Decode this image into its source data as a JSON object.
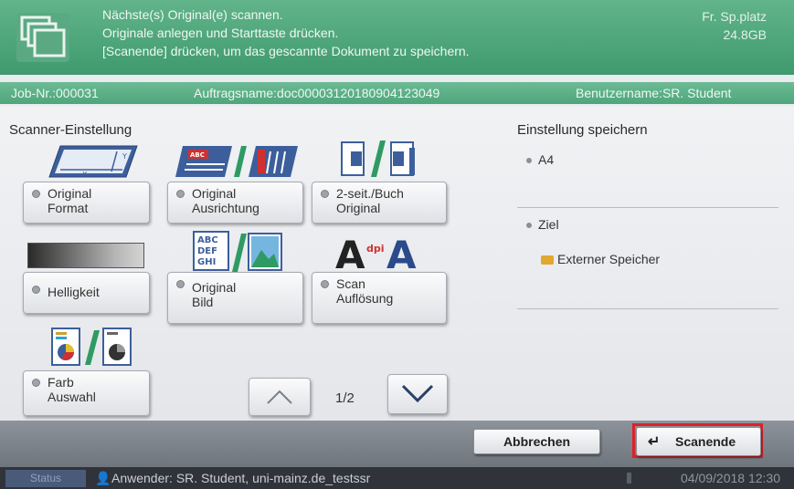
{
  "header": {
    "messages": [
      "Nächste(s) Original(e) scannen.",
      "Originale anlegen und Starttaste drücken.",
      "[Scanende] drücken, um das gescannte Dokument zu speichern."
    ],
    "free_space_label": "Fr. Sp.platz",
    "free_space_value": "24.8GB"
  },
  "jobbar": {
    "job_nr": "Job-Nr.:000031",
    "job_name": "Auftragsname:doc00003120180904123049",
    "user_name": "Benutzername:SR. Student"
  },
  "scanner": {
    "title": "Scanner-Einstellung",
    "buttons": {
      "original_format": "Original\nFormat",
      "original_ausrichtung": "Original\nAusrichtung",
      "duplex_original": "2-seit./Buch\nOriginal",
      "helligkeit": "Helligkeit",
      "original_bild": "Original\nBild",
      "scan_aufloesung": "Scan\nAuflösung",
      "farb_auswahl": "Farb\nAuswahl"
    },
    "icon_text": {
      "abc": "ABC",
      "abc_stack": [
        "ABC",
        "DEF",
        "GHI"
      ],
      "dpi": "dpi",
      "res_a": "A"
    },
    "pagination": "1/2"
  },
  "right": {
    "title": "Einstellung speichern",
    "format_value": "A4",
    "ziel_label": "Ziel",
    "ziel_value": "Externer Speicher"
  },
  "actions": {
    "abbrechen": "Abbrechen",
    "scanende": "Scanende"
  },
  "status": {
    "tab": "Status",
    "user": "Anwender: SR. Student, uni-mainz.de_testssr",
    "datetime": "04/09/2018  12:30"
  },
  "colors": {
    "accent_green": "#4ea57c",
    "highlight_red": "#e0202a"
  }
}
